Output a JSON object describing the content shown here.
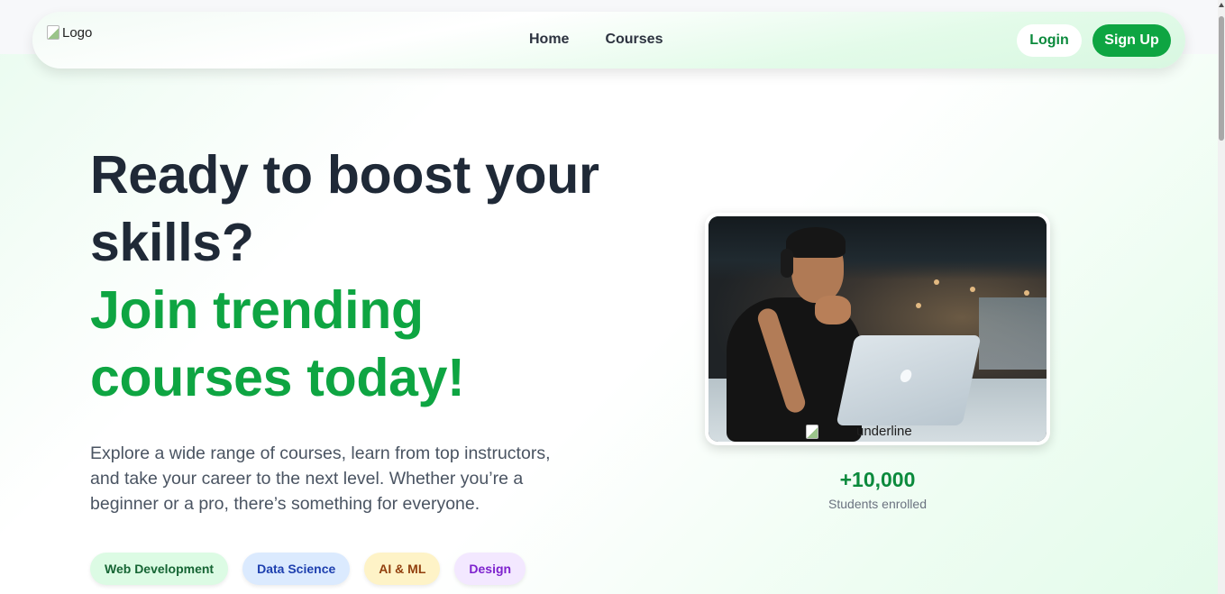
{
  "navbar": {
    "logo_alt": "Logo",
    "links": [
      {
        "label": "Home"
      },
      {
        "label": "Courses"
      }
    ],
    "login_label": "Login",
    "signup_label": "Sign Up"
  },
  "hero": {
    "title_line1": "Ready to boost your",
    "title_line2": "skills?",
    "title_highlight_line1": "Join trending",
    "title_highlight_line2": "courses today!",
    "description": "Explore a wide range of courses, learn from top instructors, and take your career to the next level. Whether you’re a beginner or a pro, there’s something for everyone.",
    "tags": [
      {
        "label": "Web Development"
      },
      {
        "label": "Data Science"
      },
      {
        "label": "AI & ML"
      },
      {
        "label": "Design"
      }
    ],
    "underline_alt": "underline",
    "stat_number": "+10,000",
    "stat_label": "Students enrolled"
  },
  "colors": {
    "brand_green": "#0ea542",
    "dark_text": "#1f2937"
  }
}
